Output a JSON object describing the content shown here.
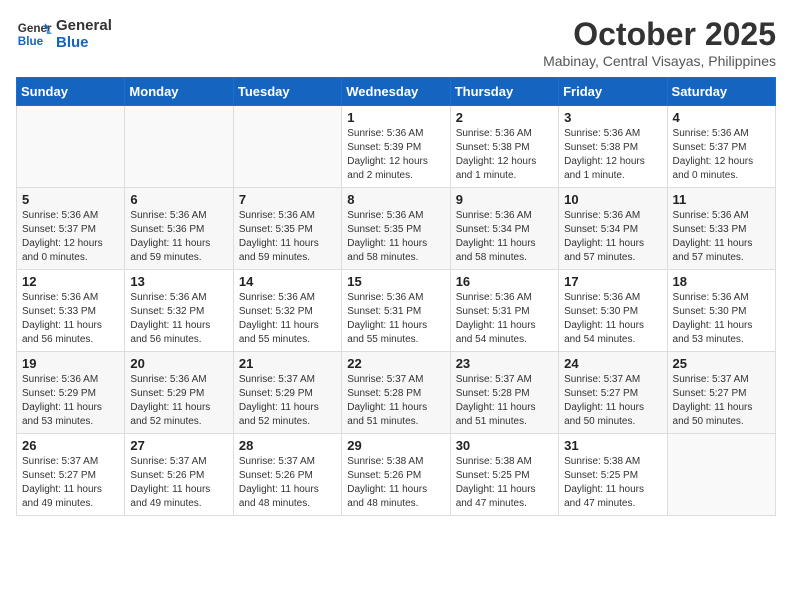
{
  "header": {
    "logo_general": "General",
    "logo_blue": "Blue",
    "month": "October 2025",
    "location": "Mabinay, Central Visayas, Philippines"
  },
  "days_of_week": [
    "Sunday",
    "Monday",
    "Tuesday",
    "Wednesday",
    "Thursday",
    "Friday",
    "Saturday"
  ],
  "weeks": [
    [
      {
        "day": "",
        "info": ""
      },
      {
        "day": "",
        "info": ""
      },
      {
        "day": "",
        "info": ""
      },
      {
        "day": "1",
        "info": "Sunrise: 5:36 AM\nSunset: 5:39 PM\nDaylight: 12 hours\nand 2 minutes."
      },
      {
        "day": "2",
        "info": "Sunrise: 5:36 AM\nSunset: 5:38 PM\nDaylight: 12 hours\nand 1 minute."
      },
      {
        "day": "3",
        "info": "Sunrise: 5:36 AM\nSunset: 5:38 PM\nDaylight: 12 hours\nand 1 minute."
      },
      {
        "day": "4",
        "info": "Sunrise: 5:36 AM\nSunset: 5:37 PM\nDaylight: 12 hours\nand 0 minutes."
      }
    ],
    [
      {
        "day": "5",
        "info": "Sunrise: 5:36 AM\nSunset: 5:37 PM\nDaylight: 12 hours\nand 0 minutes."
      },
      {
        "day": "6",
        "info": "Sunrise: 5:36 AM\nSunset: 5:36 PM\nDaylight: 11 hours\nand 59 minutes."
      },
      {
        "day": "7",
        "info": "Sunrise: 5:36 AM\nSunset: 5:35 PM\nDaylight: 11 hours\nand 59 minutes."
      },
      {
        "day": "8",
        "info": "Sunrise: 5:36 AM\nSunset: 5:35 PM\nDaylight: 11 hours\nand 58 minutes."
      },
      {
        "day": "9",
        "info": "Sunrise: 5:36 AM\nSunset: 5:34 PM\nDaylight: 11 hours\nand 58 minutes."
      },
      {
        "day": "10",
        "info": "Sunrise: 5:36 AM\nSunset: 5:34 PM\nDaylight: 11 hours\nand 57 minutes."
      },
      {
        "day": "11",
        "info": "Sunrise: 5:36 AM\nSunset: 5:33 PM\nDaylight: 11 hours\nand 57 minutes."
      }
    ],
    [
      {
        "day": "12",
        "info": "Sunrise: 5:36 AM\nSunset: 5:33 PM\nDaylight: 11 hours\nand 56 minutes."
      },
      {
        "day": "13",
        "info": "Sunrise: 5:36 AM\nSunset: 5:32 PM\nDaylight: 11 hours\nand 56 minutes."
      },
      {
        "day": "14",
        "info": "Sunrise: 5:36 AM\nSunset: 5:32 PM\nDaylight: 11 hours\nand 55 minutes."
      },
      {
        "day": "15",
        "info": "Sunrise: 5:36 AM\nSunset: 5:31 PM\nDaylight: 11 hours\nand 55 minutes."
      },
      {
        "day": "16",
        "info": "Sunrise: 5:36 AM\nSunset: 5:31 PM\nDaylight: 11 hours\nand 54 minutes."
      },
      {
        "day": "17",
        "info": "Sunrise: 5:36 AM\nSunset: 5:30 PM\nDaylight: 11 hours\nand 54 minutes."
      },
      {
        "day": "18",
        "info": "Sunrise: 5:36 AM\nSunset: 5:30 PM\nDaylight: 11 hours\nand 53 minutes."
      }
    ],
    [
      {
        "day": "19",
        "info": "Sunrise: 5:36 AM\nSunset: 5:29 PM\nDaylight: 11 hours\nand 53 minutes."
      },
      {
        "day": "20",
        "info": "Sunrise: 5:36 AM\nSunset: 5:29 PM\nDaylight: 11 hours\nand 52 minutes."
      },
      {
        "day": "21",
        "info": "Sunrise: 5:37 AM\nSunset: 5:29 PM\nDaylight: 11 hours\nand 52 minutes."
      },
      {
        "day": "22",
        "info": "Sunrise: 5:37 AM\nSunset: 5:28 PM\nDaylight: 11 hours\nand 51 minutes."
      },
      {
        "day": "23",
        "info": "Sunrise: 5:37 AM\nSunset: 5:28 PM\nDaylight: 11 hours\nand 51 minutes."
      },
      {
        "day": "24",
        "info": "Sunrise: 5:37 AM\nSunset: 5:27 PM\nDaylight: 11 hours\nand 50 minutes."
      },
      {
        "day": "25",
        "info": "Sunrise: 5:37 AM\nSunset: 5:27 PM\nDaylight: 11 hours\nand 50 minutes."
      }
    ],
    [
      {
        "day": "26",
        "info": "Sunrise: 5:37 AM\nSunset: 5:27 PM\nDaylight: 11 hours\nand 49 minutes."
      },
      {
        "day": "27",
        "info": "Sunrise: 5:37 AM\nSunset: 5:26 PM\nDaylight: 11 hours\nand 49 minutes."
      },
      {
        "day": "28",
        "info": "Sunrise: 5:37 AM\nSunset: 5:26 PM\nDaylight: 11 hours\nand 48 minutes."
      },
      {
        "day": "29",
        "info": "Sunrise: 5:38 AM\nSunset: 5:26 PM\nDaylight: 11 hours\nand 48 minutes."
      },
      {
        "day": "30",
        "info": "Sunrise: 5:38 AM\nSunset: 5:25 PM\nDaylight: 11 hours\nand 47 minutes."
      },
      {
        "day": "31",
        "info": "Sunrise: 5:38 AM\nSunset: 5:25 PM\nDaylight: 11 hours\nand 47 minutes."
      },
      {
        "day": "",
        "info": ""
      }
    ]
  ]
}
